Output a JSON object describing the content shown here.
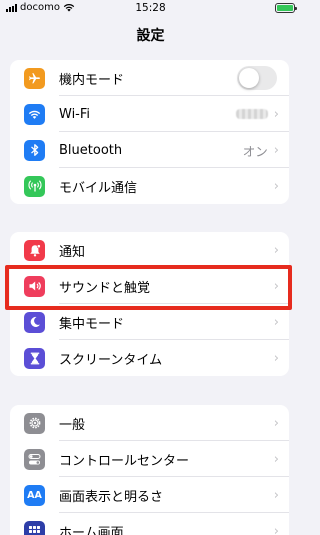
{
  "status_bar": {
    "carrier": "docomo",
    "time": "15:28"
  },
  "page": {
    "title": "設定"
  },
  "groups": [
    {
      "items": [
        {
          "label": "機内モード",
          "icon": "airplane-icon",
          "color": "#f29a1f",
          "accessory": "toggle",
          "toggle_on": false
        },
        {
          "label": "Wi-Fi",
          "icon": "wifi-icon",
          "color": "#1f7cf4",
          "accessory": "obscured-value"
        },
        {
          "label": "Bluetooth",
          "icon": "bluetooth-icon",
          "color": "#1f7cf4",
          "value": "オン"
        },
        {
          "label": "モバイル通信",
          "icon": "antenna-icon",
          "color": "#34c759"
        }
      ]
    },
    {
      "items": [
        {
          "label": "通知",
          "icon": "bell-icon",
          "color": "#f13a4a"
        },
        {
          "label": "サウンドと触覚",
          "icon": "speaker-icon",
          "color": "#ef3d5c"
        },
        {
          "label": "集中モード",
          "icon": "moon-icon",
          "color": "#5b4ed6"
        },
        {
          "label": "スクリーンタイム",
          "icon": "hourglass-icon",
          "color": "#5b4ed6"
        }
      ]
    },
    {
      "items": [
        {
          "label": "一般",
          "icon": "gear-icon",
          "color": "#8e8e93"
        },
        {
          "label": "コントロールセンター",
          "icon": "switches-icon",
          "color": "#8e8e93"
        },
        {
          "label": "画面表示と明るさ",
          "icon": "aa-icon",
          "color": "#1f7cf4",
          "icon_text": "AA"
        },
        {
          "label": "ホーム画面",
          "icon": "grid-icon",
          "color": "#2d3ea8"
        }
      ]
    }
  ],
  "highlight": {
    "target": "サウンドと触覚",
    "color": "#e62b1e"
  }
}
